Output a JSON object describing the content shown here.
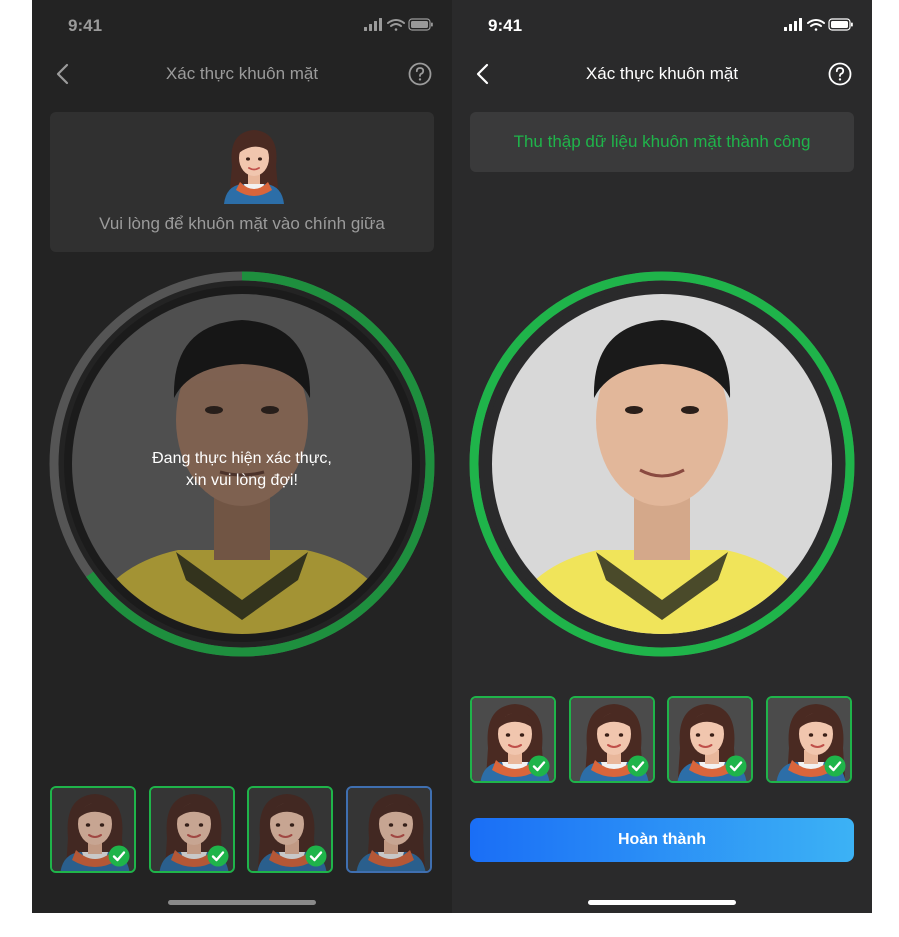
{
  "left_screen": {
    "status": {
      "time": "9:41"
    },
    "nav": {
      "title": "Xác thực khuôn mặt"
    },
    "hint": {
      "text": "Vui lòng để khuôn mặt vào chính giữa"
    },
    "overlay_text": "Đang thực hiện xác thực,\nxin vui lòng đợi!",
    "progress": 0.65,
    "thumbnails": [
      {
        "pose": "front",
        "completed": true
      },
      {
        "pose": "front",
        "completed": true
      },
      {
        "pose": "left",
        "completed": true
      },
      {
        "pose": "right",
        "completed": false
      }
    ]
  },
  "right_screen": {
    "status": {
      "time": "9:41"
    },
    "nav": {
      "title": "Xác thực khuôn mặt"
    },
    "success": {
      "text": "Thu thập dữ liệu khuôn mặt thành công"
    },
    "progress": 1.0,
    "thumbnails": [
      {
        "pose": "front",
        "completed": true
      },
      {
        "pose": "front",
        "completed": true
      },
      {
        "pose": "left",
        "completed": true
      },
      {
        "pose": "right",
        "completed": true
      }
    ],
    "done_button": {
      "label": "Hoàn thành"
    }
  },
  "colors": {
    "success_green": "#1fb44a",
    "ring_gray": "#6b6b6b",
    "thumb_active_border": "#3f6fb0",
    "button_gradient_start": "#1a6ef6",
    "button_gradient_end": "#3cb2f5"
  }
}
